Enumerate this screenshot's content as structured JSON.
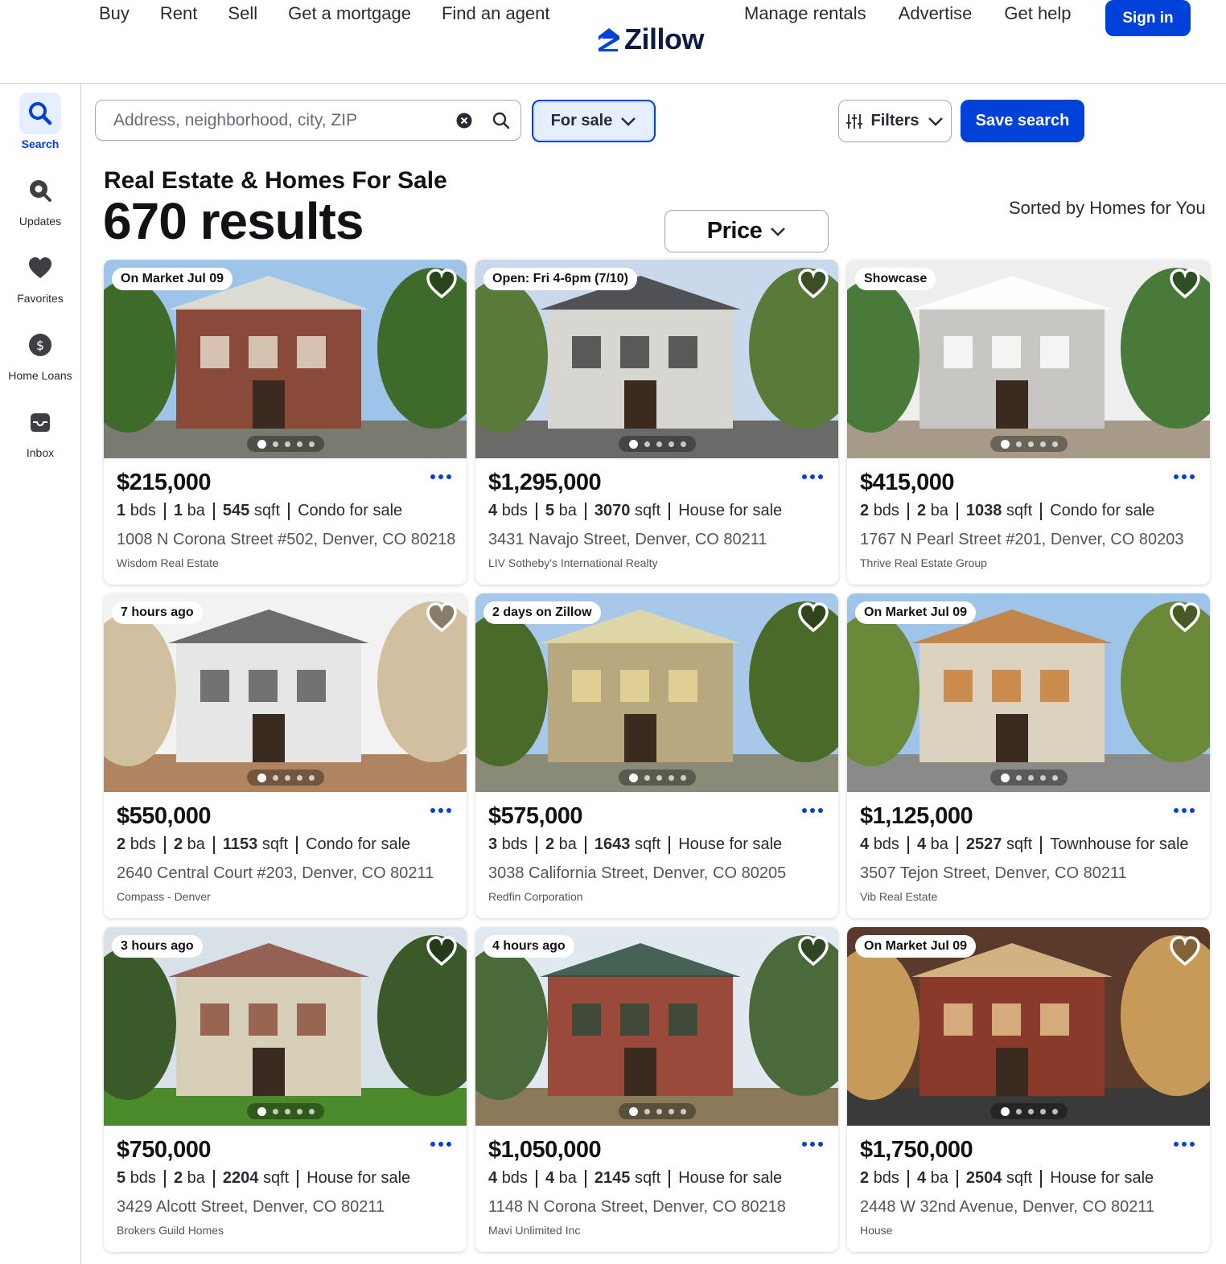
{
  "nav": {
    "left": [
      "Buy",
      "Rent",
      "Sell",
      "Get a mortgage",
      "Find an agent"
    ],
    "right": [
      "Manage rentals",
      "Advertise",
      "Get help"
    ],
    "logo": "Zillow",
    "signin": "Sign in"
  },
  "sidebar": {
    "items": [
      {
        "label": "Search",
        "icon": "search-icon"
      },
      {
        "label": "Updates",
        "icon": "updates-icon"
      },
      {
        "label": "Favorites",
        "icon": "heart-icon"
      },
      {
        "label": "Home Loans",
        "icon": "dollar-icon"
      },
      {
        "label": "Inbox",
        "icon": "inbox-icon"
      }
    ]
  },
  "search": {
    "placeholder": "Address, neighborhood, city, ZIP",
    "value": ""
  },
  "filters": {
    "sale": "For sale",
    "price": "Price",
    "more": "Filters",
    "save": "Save search"
  },
  "heading": {
    "title": "Real Estate & Homes For Sale",
    "results": "670 results",
    "sorted": "Sorted by Homes for You"
  },
  "listings": [
    {
      "badge": "On Market Jul 09",
      "price": "$215,000",
      "beds": "1",
      "baths": "1",
      "sqft": "545",
      "type": "Condo for sale",
      "address": "1008 N Corona Street #502, Denver, CO 80218",
      "broker": "Wisdom Real Estate"
    },
    {
      "badge": "Open: Fri 4-6pm (7/10)",
      "price": "$1,295,000",
      "beds": "4",
      "baths": "5",
      "sqft": "3070",
      "type": "House for sale",
      "address": "3431 Navajo Street, Denver, CO 80211",
      "broker": "LIV Sotheby's International Realty"
    },
    {
      "badge": "Showcase",
      "price": "$415,000",
      "beds": "2",
      "baths": "2",
      "sqft": "1038",
      "type": "Condo for sale",
      "address": "1767 N Pearl Street #201, Denver, CO 80203",
      "broker": "Thrive Real Estate Group"
    },
    {
      "badge": "7 hours ago",
      "price": "$550,000",
      "beds": "2",
      "baths": "2",
      "sqft": "1153",
      "type": "Condo for sale",
      "address": "2640 Central Court #203, Denver, CO 80211",
      "broker": "Compass - Denver"
    },
    {
      "badge": "2 days on Zillow",
      "price": "$575,000",
      "beds": "3",
      "baths": "2",
      "sqft": "1643",
      "type": "House for sale",
      "address": "3038 California Street, Denver, CO 80205",
      "broker": "Redfin Corporation"
    },
    {
      "badge": "On Market Jul 09",
      "price": "$1,125,000",
      "beds": "4",
      "baths": "4",
      "sqft": "2527",
      "type": "Townhouse for sale",
      "address": "3507 Tejon Street, Denver, CO 80211",
      "broker": "Vib Real Estate"
    },
    {
      "badge": "3 hours ago",
      "price": "$750,000",
      "beds": "5",
      "baths": "2",
      "sqft": "2204",
      "type": "House for sale",
      "address": "3429 Alcott Street, Denver, CO 80211",
      "broker": "Brokers Guild Homes"
    },
    {
      "badge": "4 hours ago",
      "price": "$1,050,000",
      "beds": "4",
      "baths": "4",
      "sqft": "2145",
      "type": "House for sale",
      "address": "1148 N Corona Street, Denver, CO 80218",
      "broker": "Mavi Unlimited Inc"
    },
    {
      "badge": "On Market Jul 09",
      "price": "$1,750,000",
      "beds": "2",
      "baths": "4",
      "sqft": "2504",
      "type": "House for sale",
      "address": "2448 W 32nd Avenue, Denver, CO 80211",
      "broker": "House"
    }
  ],
  "units": {
    "beds": "bds",
    "baths": "ba",
    "sqft": "sqft"
  },
  "colors": {
    "accent": "#0041d9",
    "text": "#2a2a33"
  }
}
